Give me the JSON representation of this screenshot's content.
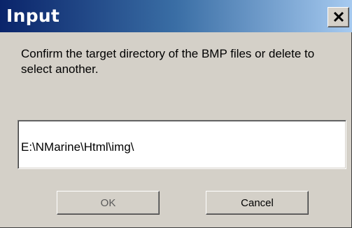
{
  "window": {
    "title": "Input",
    "close_icon": "close-icon"
  },
  "dialog": {
    "prompt": "Confirm the target directory of the BMP files or delete to select another.",
    "input_value": "E:\\NMarine\\Html\\img\\"
  },
  "buttons": {
    "ok_label": "OK",
    "cancel_label": "Cancel"
  },
  "colors": {
    "titlebar_start": "#0a246a",
    "titlebar_end": "#a6caf0",
    "face": "#d4d0c8"
  }
}
